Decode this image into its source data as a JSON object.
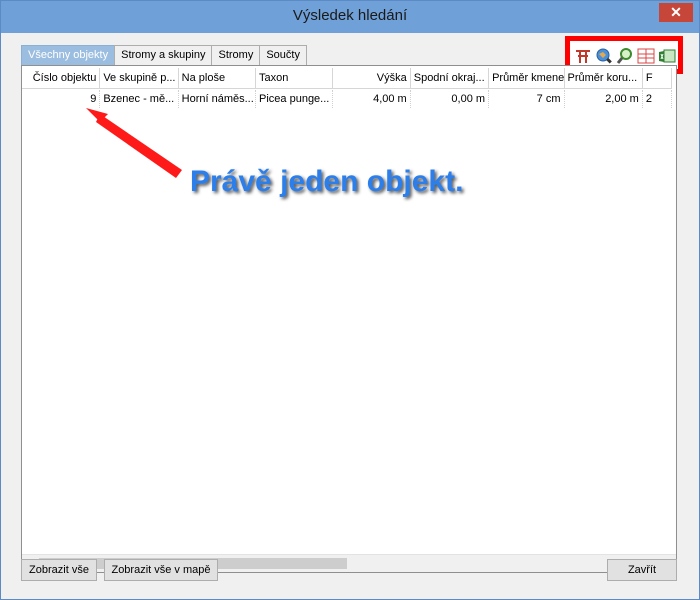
{
  "window": {
    "title": "Výsledek hledání",
    "close_glyph": "✕"
  },
  "tabs": [
    {
      "label": "Všechny objekty",
      "active": true
    },
    {
      "label": "Stromy a skupiny",
      "active": false
    },
    {
      "label": "Stromy",
      "active": false
    },
    {
      "label": "Součty",
      "active": false
    }
  ],
  "grid": {
    "columns": [
      "Číslo objektu",
      "Ve skupině p...",
      "Na ploše",
      "Taxon",
      "Výška",
      "Spodní okraj...",
      "Průměr kmene",
      "Průměr koru...",
      "F"
    ],
    "rows": [
      [
        "9",
        "Bzenec - mě...",
        "Horní náměs...",
        "Picea punge...",
        "4,00 m",
        "0,00 m",
        "7 cm",
        "2,00 m",
        "2"
      ]
    ]
  },
  "toolbar": {
    "icons": [
      "filter-icon",
      "map-zoom-icon",
      "search-icon",
      "table-icon",
      "excel-export-icon"
    ],
    "highlight_color": "#ff0000"
  },
  "annotation": {
    "text": "Právě jeden objekt.",
    "color": "#2c7fea",
    "arrow_color": "#ff1a1a"
  },
  "buttons": {
    "show_all": "Zobrazit vše",
    "show_all_map": "Zobrazit vše v mapě",
    "close": "Zavřít"
  }
}
